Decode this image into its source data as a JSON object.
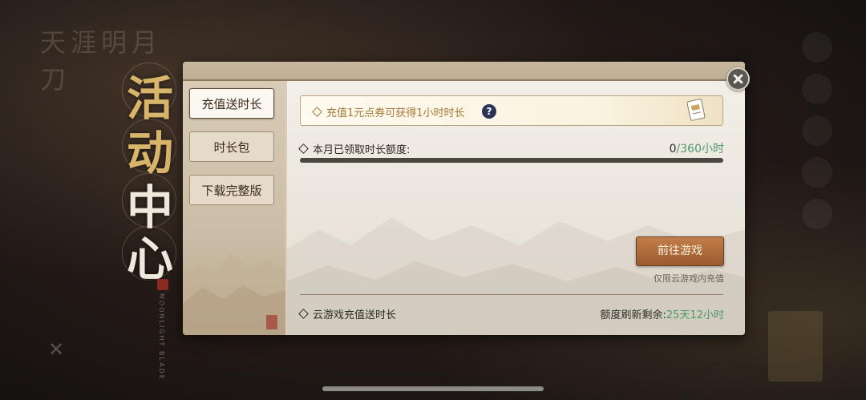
{
  "title": {
    "chars": [
      "活",
      "动",
      "中",
      "心"
    ]
  },
  "sidebar": {
    "tabs": [
      {
        "label": "充值送时长",
        "active": true
      },
      {
        "label": "时长包",
        "active": false
      },
      {
        "label": "下载完整版",
        "active": false
      }
    ]
  },
  "banner": {
    "text": "充值1元点券可获得1小时时长",
    "help_icon": "?",
    "ticket_icon": "ticket-icon"
  },
  "quota": {
    "label": "本月已领取时长额度:",
    "current": "0",
    "separator": "/",
    "max": "360小时",
    "progress_fraction": 0
  },
  "action": {
    "go_button": "前往游戏",
    "note": "仅限云游戏内充值"
  },
  "footer": {
    "left": "云游戏充值送时长",
    "right_label": "额度刷新剩余:",
    "right_value": "25天12小时"
  },
  "colors": {
    "accent_gold": "#a47a34",
    "accent_green": "#4b9a6c",
    "button_brown": "#9b5b2f"
  }
}
